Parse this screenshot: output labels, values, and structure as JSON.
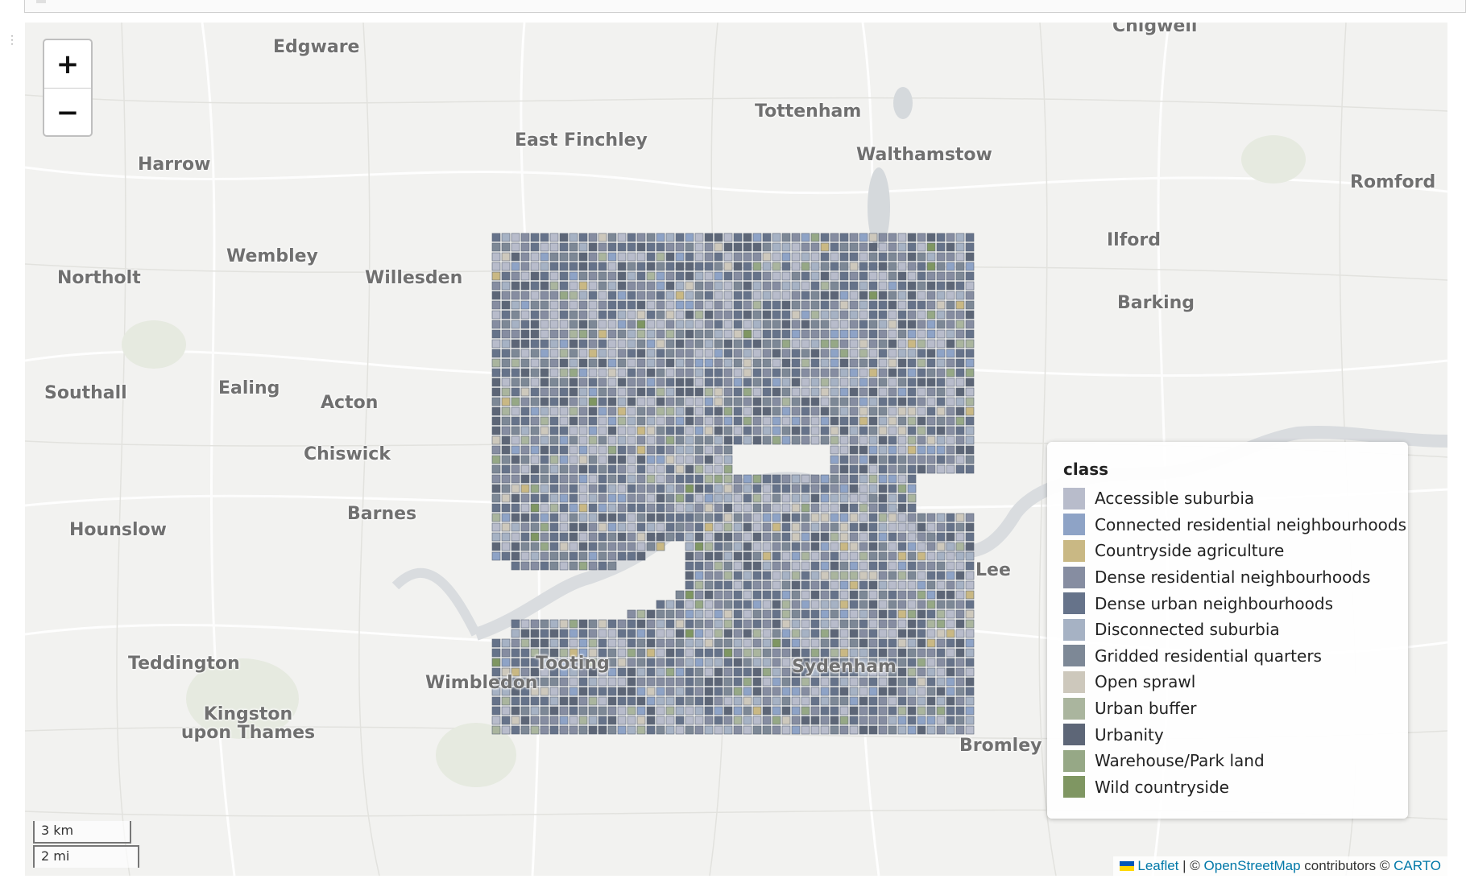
{
  "map": {
    "places": [
      {
        "name": "Chigwell"
      },
      {
        "name": "Edgware"
      },
      {
        "name": "Tottenham"
      },
      {
        "name": "East Finchley"
      },
      {
        "name": "Walthamstow"
      },
      {
        "name": "Harrow"
      },
      {
        "name": "Romford"
      },
      {
        "name": "Ilford"
      },
      {
        "name": "Wembley"
      },
      {
        "name": "Northolt"
      },
      {
        "name": "Willesden"
      },
      {
        "name": "Barking"
      },
      {
        "name": "Southall"
      },
      {
        "name": "Ealing"
      },
      {
        "name": "Acton"
      },
      {
        "name": "Chiswick"
      },
      {
        "name": "Barnes"
      },
      {
        "name": "Hounslow"
      },
      {
        "name": "Lee"
      },
      {
        "name": "Teddington"
      },
      {
        "name": "Tooting"
      },
      {
        "name": "Sydenham"
      },
      {
        "name": "Wimbledon"
      },
      {
        "name": "Kingston upon Thames"
      },
      {
        "name": "Bromley"
      }
    ],
    "zoom_in_label": "+",
    "zoom_out_label": "−"
  },
  "legend": {
    "title": "class",
    "items": [
      {
        "label": "Accessible suburbia",
        "color": "#b8bccb"
      },
      {
        "label": "Connected residential neighbourhoods",
        "color": "#8ea3c6"
      },
      {
        "label": "Countryside agriculture",
        "color": "#c9b884"
      },
      {
        "label": "Dense residential neighbourhoods",
        "color": "#868da1"
      },
      {
        "label": "Dense urban neighbourhoods",
        "color": "#66738a"
      },
      {
        "label": "Disconnected suburbia",
        "color": "#a6b2c4"
      },
      {
        "label": "Gridded residential quarters",
        "color": "#7d8896"
      },
      {
        "label": "Open sprawl",
        "color": "#cdc8bc"
      },
      {
        "label": "Urban buffer",
        "color": "#aab59e"
      },
      {
        "label": "Urbanity",
        "color": "#5d6677"
      },
      {
        "label": "Warehouse/Park land",
        "color": "#96a886"
      },
      {
        "label": "Wild countryside",
        "color": "#7f9662"
      }
    ]
  },
  "scale": {
    "km": "3 km",
    "mi": "2 mi"
  },
  "attribution": {
    "leaflet": "Leaflet",
    "sep": "| ©",
    "osm": "OpenStreetMap",
    "contrib": "contributors ©",
    "carto": "CARTO"
  }
}
